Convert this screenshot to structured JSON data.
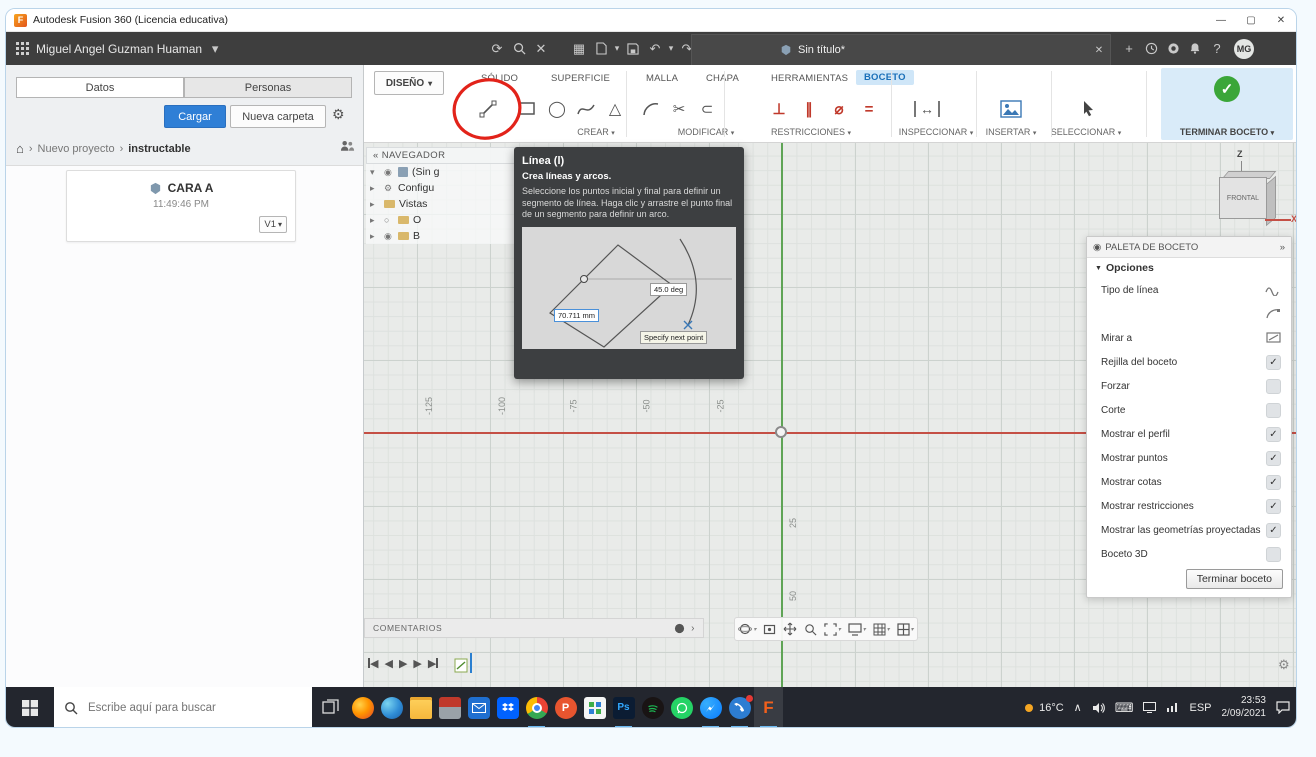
{
  "titlebar": {
    "title": "Autodesk Fusion 360 (Licencia educativa)"
  },
  "window_controls": {
    "minimize": "—",
    "maximize": "▢",
    "close": "✕"
  },
  "appbar": {
    "user_name": "Miguel Angel Guzman Huaman",
    "doc_tab": "Sin título*",
    "avatar_initials": "MG"
  },
  "data_panel": {
    "tab_datos": "Datos",
    "tab_personas": "Personas",
    "upload_button": "Cargar",
    "new_folder_button": "Nueva carpeta",
    "breadcrumb_project": "Nuevo proyecto",
    "breadcrumb_folder": "instructable",
    "file_name": "CARA A",
    "file_time": "11:49:46 PM",
    "file_version": "V1"
  },
  "ribbon": {
    "design_label": "DISEÑO",
    "tabs": [
      "SÓLIDO",
      "SUPERFICIE",
      "MALLA",
      "CHAPA",
      "HERRAMIENTAS",
      "BOCETO"
    ],
    "active_tab": "BOCETO",
    "groups": [
      "CREAR",
      "MODIFICAR",
      "RESTRICCIONES",
      "INSPECCIONAR",
      "INSERTAR",
      "SELECCIONAR",
      "TERMINAR BOCETO"
    ]
  },
  "navigator": {
    "title": "NAVEGADOR",
    "items": [
      "(Sin g",
      "Configu",
      "Vistas",
      "O",
      "B"
    ]
  },
  "tooltip": {
    "title": "Línea (l)",
    "subtitle": "Crea líneas y arcos.",
    "body": "Seleccione los puntos inicial y final para definir un segmento de línea. Haga clic y arrastre el punto final de un segmento para definir un arco.",
    "dim_length": "70.711 mm",
    "dim_angle": "45.0 deg",
    "hint": "Specify next point"
  },
  "canvas": {
    "x_ticks": [
      "-125",
      "-100",
      "-75",
      "-50",
      "-25"
    ],
    "y_ticks": [
      "25",
      "50"
    ]
  },
  "viewcube": {
    "front": "FRONTAL",
    "z": "Z",
    "x": "X"
  },
  "palette": {
    "title": "PALETA DE BOCETO",
    "section": "Opciones",
    "rows": [
      {
        "label": "Tipo de línea",
        "mark": ""
      },
      {
        "label": "",
        "mark": ""
      },
      {
        "label": "Mirar a",
        "mark": ""
      },
      {
        "label": "Rejilla del boceto",
        "mark": "✓"
      },
      {
        "label": "Forzar",
        "mark": ""
      },
      {
        "label": "Corte",
        "mark": ""
      },
      {
        "label": "Mostrar el perfil",
        "mark": "✓"
      },
      {
        "label": "Mostrar puntos",
        "mark": "✓"
      },
      {
        "label": "Mostrar cotas",
        "mark": "✓"
      },
      {
        "label": "Mostrar restricciones",
        "mark": "✓"
      },
      {
        "label": "Mostrar las geometrías proyectadas",
        "mark": "✓"
      },
      {
        "label": "Boceto 3D",
        "mark": ""
      }
    ],
    "finish_button": "Terminar boceto"
  },
  "comments_bar": {
    "label": "COMENTARIOS"
  },
  "taskbar": {
    "search_placeholder": "Escribe aquí para buscar",
    "apps": [
      {
        "name": "firefox",
        "running": false
      },
      {
        "name": "edge",
        "running": false
      },
      {
        "name": "file-explorer",
        "running": false
      },
      {
        "name": "toolbox-app",
        "running": false
      },
      {
        "name": "mail",
        "running": false
      },
      {
        "name": "dropbox",
        "running": false
      },
      {
        "name": "chrome",
        "running": true
      },
      {
        "name": "p-badge-app",
        "running": false
      },
      {
        "name": "office-grid-app",
        "running": false
      },
      {
        "name": "photoshop",
        "running": true
      },
      {
        "name": "spotify",
        "running": false
      },
      {
        "name": "whatsapp",
        "running": false
      },
      {
        "name": "messenger",
        "running": true
      },
      {
        "name": "calls-app",
        "running": true
      },
      {
        "name": "fusion-360",
        "running": true
      }
    ],
    "tray": {
      "temp": "16°C",
      "lang": "ESP",
      "time": "23:53",
      "date": "2/09/2021"
    }
  },
  "icons": {
    "fusion_logo": "F",
    "caret": "▾",
    "refresh": "⟳",
    "panel_close": "✕",
    "grid_btn": "▦",
    "undo": "↶",
    "redo": "↷",
    "tab_close": "✕",
    "tab_new": "+",
    "help": "?",
    "home": "⌂",
    "crumb_sep": "›",
    "gear": "⚙",
    "tree_open": "▾",
    "tree_closed": "▸",
    "eye": "◉",
    "eye_off": "○",
    "nav_collapse": "«",
    "tool_circle": "◯",
    "tool_polygon": "△",
    "tool_offset": "⊂",
    "tool_trim": "✂",
    "con_perp": "⊥",
    "con_par": "∥",
    "con_tan": "⌀",
    "con_eq": "=",
    "dim_arrow": "↔",
    "palette_dot": "◉",
    "palette_collapse": "»",
    "section_caret": "▼",
    "comments_chev": "›",
    "tl_back": "◀",
    "tl_play": "▶",
    "tray_chevron": "∧",
    "keyboard": "⌨",
    "ps_label": "Ps",
    "p_label": "P",
    "check_glyph": "✓"
  }
}
